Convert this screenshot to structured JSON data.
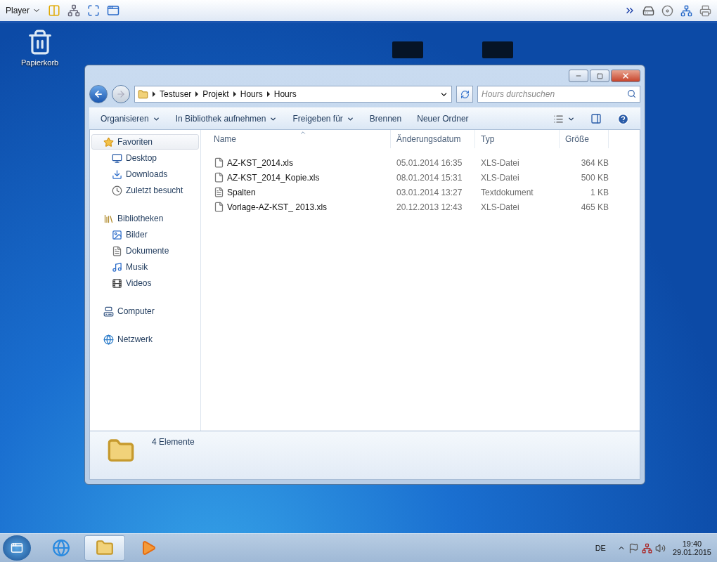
{
  "player_bar": {
    "label": "Player"
  },
  "desktop_icons": [
    {
      "label": "Papierkorb"
    }
  ],
  "window": {
    "breadcrumb": [
      "Testuser",
      "Projekt",
      "Hours",
      "Hours"
    ],
    "search": {
      "placeholder": "Hours durchsuchen"
    },
    "commands": [
      {
        "label": "Organisieren",
        "dropdown": true
      },
      {
        "label": "In Bibliothek aufnehmen",
        "dropdown": true
      },
      {
        "label": "Freigeben für",
        "dropdown": true
      },
      {
        "label": "Brennen",
        "dropdown": false
      },
      {
        "label": "Neuer Ordner",
        "dropdown": false
      }
    ],
    "sidebar": {
      "groups": [
        {
          "label": "Favoriten",
          "kind": "star",
          "selected": true,
          "children": [
            {
              "label": "Desktop",
              "kind": "desktop",
              "selected": false
            },
            {
              "label": "Downloads",
              "kind": "download",
              "selected": false
            },
            {
              "label": "Zuletzt besucht",
              "kind": "recent",
              "selected": false
            }
          ]
        },
        {
          "label": "Bibliotheken",
          "kind": "library",
          "selected": false,
          "children": [
            {
              "label": "Bilder",
              "kind": "image",
              "selected": false
            },
            {
              "label": "Dokumente",
              "kind": "document",
              "selected": false
            },
            {
              "label": "Musik",
              "kind": "music",
              "selected": false
            },
            {
              "label": "Videos",
              "kind": "video",
              "selected": false
            }
          ]
        },
        {
          "label": "Computer",
          "kind": "computer",
          "selected": false
        },
        {
          "label": "Netzwerk",
          "kind": "network",
          "selected": false
        }
      ]
    },
    "table": {
      "columns": [
        {
          "label": "Name",
          "sorted": true
        },
        {
          "label": "Änderungsdatum",
          "sorted": false
        },
        {
          "label": "Typ",
          "sorted": false
        },
        {
          "label": "Größe",
          "sorted": false
        }
      ],
      "rows": [
        {
          "kind": "sheet",
          "name": "AZ-KST_2014.xls",
          "date": "05.01.2014 16:35",
          "type": "XLS-Datei",
          "size": "364 KB"
        },
        {
          "kind": "sheet",
          "name": "AZ-KST_2014_Kopie.xls",
          "date": "08.01.2014 15:31",
          "type": "XLS-Datei",
          "size": "500 KB"
        },
        {
          "kind": "text",
          "name": "Spalten",
          "date": "03.01.2014 13:27",
          "type": "Textdokument",
          "size": "1 KB"
        },
        {
          "kind": "sheet",
          "name": "Vorlage-AZ-KST_ 2013.xls",
          "date": "20.12.2013 12:43",
          "type": "XLS-Datei",
          "size": "465 KB"
        }
      ]
    },
    "status_bar": {
      "text": "4 Elemente"
    }
  },
  "taskbar": {
    "apps": [
      {
        "kind": "browser",
        "selected": false
      },
      {
        "kind": "explorer",
        "selected": true
      },
      {
        "kind": "media",
        "selected": false
      }
    ],
    "language": "DE",
    "time": "19:40",
    "date": "29.01.2015"
  }
}
